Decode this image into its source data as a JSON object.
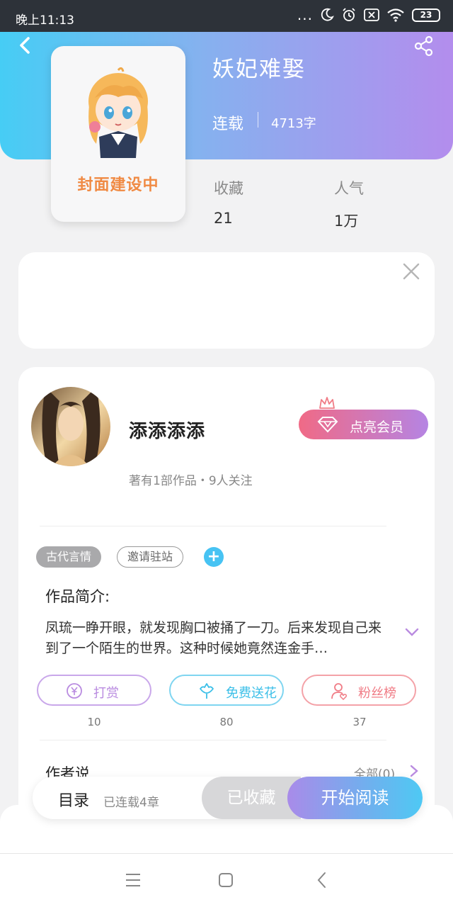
{
  "status_bar": {
    "time": "晚上11:13",
    "indicators": "...",
    "battery": "23"
  },
  "book": {
    "title": "妖妃难娶",
    "status": "连载",
    "word_count": "4713字",
    "cover_text": "封面建设中",
    "stats": [
      {
        "label": "收藏",
        "value": "21"
      },
      {
        "label": "人气",
        "value": "1万"
      }
    ]
  },
  "author": {
    "name": "添添添添",
    "meta": "著有1部作品・9人关注",
    "vip_button": "点亮会员"
  },
  "tags": {
    "genre": "古代言情",
    "invite": "邀请驻站",
    "add": "+"
  },
  "intro": {
    "title": "作品简介:",
    "text": "凤琉一睁开眼，就发现胸口被捅了一刀。后来发现自己来到了一个陌生的世界。这种时候她竟然连金手…"
  },
  "actions": [
    {
      "label": "打赏",
      "count": "10",
      "color": "#b98be0"
    },
    {
      "label": "免费送花",
      "count": "80",
      "color": "#4cc8ec"
    },
    {
      "label": "粉丝榜",
      "count": "37",
      "color": "#f07c86"
    }
  ],
  "author_say": {
    "title": "作者说",
    "all_label": "全部(0)"
  },
  "bottom_bar": {
    "toc": "目录",
    "chapters": "已连载4章",
    "favorite": "已收藏",
    "read": "开始阅读"
  },
  "icons": {
    "back": "back-arrow-icon",
    "share": "share-icon",
    "close": "close-icon",
    "diamond": "diamond-icon",
    "crown": "crown-icon",
    "yen": "yen-coin-icon",
    "flower": "flower-icon",
    "fans": "fans-person-icon",
    "expand": "chevron-down-icon",
    "more": "chevron-right-icon"
  }
}
